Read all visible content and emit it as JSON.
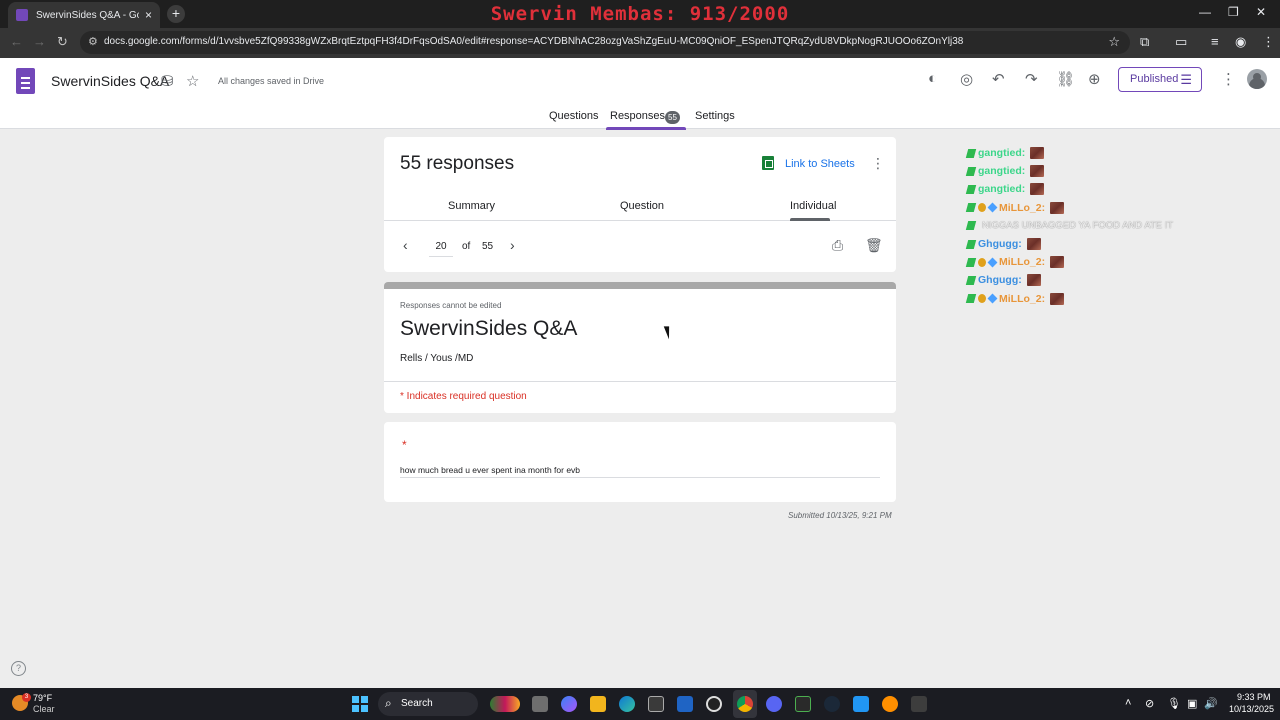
{
  "browser": {
    "tab_title": "SwervinSides Q&A - Google Fo",
    "tab_close": "×",
    "new_tab": "+",
    "overlay_title": "Swervin Membas: 913/2000",
    "url": "docs.google.com/forms/d/1vvsbve5ZfQ99338gWZxBrqtEztpqFH3f4DrFqsOdSA0/edit#response=ACYDBNhAC28ozgVaShZgEuU-MC09QniOF_ESpenJTQRqZydU8VDkpNogRJUOOo6ZOnYlj38",
    "window_controls": [
      "—",
      "❐",
      "✕"
    ]
  },
  "header": {
    "form_name": "SwervinSides Q&A",
    "saved_status": "All changes saved in Drive",
    "publish_label": "Published",
    "tabs": [
      {
        "label": "Questions"
      },
      {
        "label": "Responses"
      },
      {
        "label": "Settings"
      }
    ],
    "responses_badge": "55"
  },
  "responses_card": {
    "title": "55 responses",
    "link_sheets": "Link to Sheets",
    "subtabs": [
      "Summary",
      "Question",
      "Individual"
    ],
    "current_index": "20",
    "of_label": "of",
    "total": "55"
  },
  "form_card": {
    "no_edit_note": "Responses cannot be edited",
    "title": "SwervinSides Q&A",
    "description": "Rells / Yous /MD",
    "required_note": "* Indicates required question"
  },
  "question_card": {
    "required_marker": "*",
    "answer": "how much bread u ever spent ina month for evb"
  },
  "submitted_text": "Submitted 10/13/25, 9:21 PM",
  "chat": [
    {
      "user": "gangtied",
      "color": "#3cd68a",
      "badges": [
        "green"
      ],
      "message": ""
    },
    {
      "user": "gangtied",
      "color": "#3cd68a",
      "badges": [
        "green"
      ],
      "message": ""
    },
    {
      "user": "gangtied",
      "color": "#3cd68a",
      "badges": [
        "green"
      ],
      "message": ""
    },
    {
      "user": "MiLLo_2",
      "color": "#e8963a",
      "badges": [
        "green",
        "orange",
        "blue"
      ],
      "message": ""
    },
    {
      "user": "",
      "color": "#7fd9b0",
      "badges": [
        "green"
      ],
      "message": "NIGGAS UNBAGGED YA FOOD AND ATE IT"
    },
    {
      "user": "Ghgugg",
      "color": "#3b8fe0",
      "badges": [
        "green"
      ],
      "message": ""
    },
    {
      "user": "MiLLo_2",
      "color": "#e8963a",
      "badges": [
        "green",
        "orange",
        "blue"
      ],
      "message": ""
    },
    {
      "user": "Ghgugg",
      "color": "#3b8fe0",
      "badges": [
        "green"
      ],
      "message": ""
    },
    {
      "user": "MiLLo_2",
      "color": "#e8963a",
      "badges": [
        "green",
        "orange",
        "blue"
      ],
      "message": ""
    }
  ],
  "taskbar": {
    "weather_temp": "79°F",
    "weather_condition": "Clear",
    "weather_badge": "3",
    "search_label": "Search",
    "time": "9:33 PM",
    "date": "10/13/2025"
  },
  "colors": {
    "forms_purple": "#7248b9",
    "required_red": "#d93025",
    "link_blue": "#1a73e8",
    "sheets_green": "#188038"
  }
}
